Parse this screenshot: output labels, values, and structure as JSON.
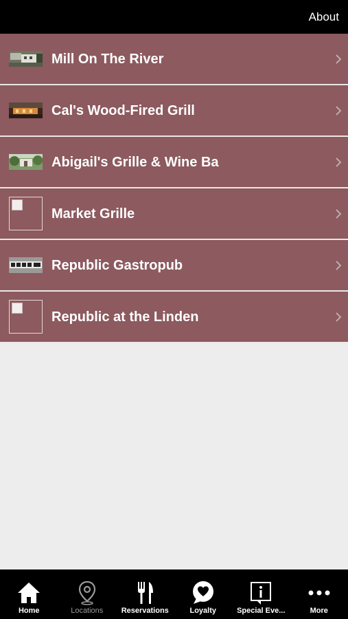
{
  "header": {
    "about_label": "About"
  },
  "locations": [
    {
      "name": "Mill On The River",
      "thumb": "photo"
    },
    {
      "name": "Cal's Wood-Fired Grill",
      "thumb": "photo"
    },
    {
      "name": "Abigail's Grille & Wine Ba",
      "thumb": "photo"
    },
    {
      "name": "Market Grille",
      "thumb": "broken-image"
    },
    {
      "name": "Republic Gastropub",
      "thumb": "photo"
    },
    {
      "name": "Republic at the Linden",
      "thumb": "broken-image"
    }
  ],
  "tabbar": {
    "tabs": [
      {
        "label": "Home",
        "icon": "home-icon"
      },
      {
        "label": "Locations",
        "icon": "map-pin-icon",
        "active": true
      },
      {
        "label": "Reservations",
        "icon": "fork-knife-icon"
      },
      {
        "label": "Loyalty",
        "icon": "heart-bubble-icon"
      },
      {
        "label": "Special Eve...",
        "icon": "info-icon"
      },
      {
        "label": "More",
        "icon": "more-dots-icon"
      }
    ]
  },
  "colors": {
    "row_bg": "#8c5a5f",
    "background": "#ededed",
    "bar_bg": "#000000",
    "active_tab": "#9a9a9a"
  }
}
